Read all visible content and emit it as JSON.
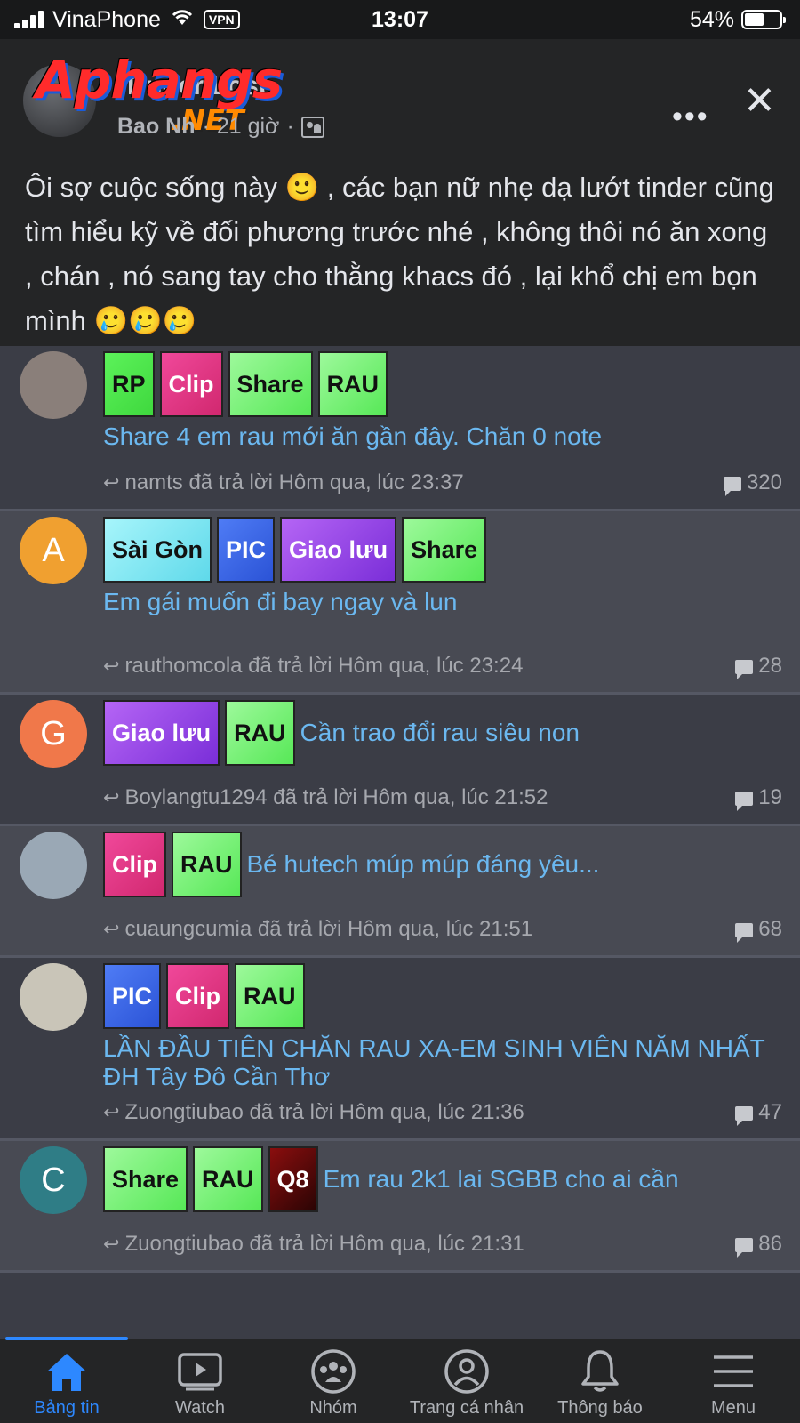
{
  "status_bar": {
    "carrier": "VinaPhone",
    "vpn": "VPN",
    "time": "13:07",
    "battery": "54%",
    "battery_level": 0.54
  },
  "post": {
    "watermark_main": "Aphangs",
    "watermark_sub": ".NET",
    "group_title": "Tinder Lost",
    "author": "Bao Nh",
    "time": "21 giờ",
    "separator": "·",
    "text": "Ôi sợ cuộc sống này 🙂 , các bạn nữ nhẹ dạ lướt tinder cũng tìm hiểu kỹ về đối phương trước nhé , không thôi nó ăn xong , chán , nó sang tay cho thằng khacs đó , lại khổ chị em bọn mình 🥲🥲🥲",
    "more_icon": "more-icon",
    "close_icon": "close-icon"
  },
  "threads": [
    {
      "tags": [
        {
          "label": "RP",
          "color": "green"
        },
        {
          "label": "Clip",
          "color": "pink"
        },
        {
          "label": "Share",
          "color": "lgreen"
        },
        {
          "label": "RAU",
          "color": "lgreen"
        }
      ],
      "title": "Share 4 em rau mới ăn gần đây. Chăn 0 note",
      "reply": "namts đã trả lời Hôm qua, lúc 23:37",
      "count": "320",
      "avatar_letter": "",
      "avatar_color": "#8a7f7a"
    },
    {
      "tags": [
        {
          "label": "Sài Gòn",
          "color": "cyan"
        },
        {
          "label": "PIC",
          "color": "blue"
        },
        {
          "label": "Giao lưu",
          "color": "purple"
        },
        {
          "label": "Share",
          "color": "lgreen"
        }
      ],
      "title": "Em gái muốn đi bay ngay và lun",
      "reply": "rauthomcola đã trả lời Hôm qua, lúc 23:24",
      "count": "28",
      "avatar_letter": "A",
      "avatar_color": "#f0a030"
    },
    {
      "tags": [
        {
          "label": "Giao lưu",
          "color": "purple"
        },
        {
          "label": "RAU",
          "color": "lgreen"
        }
      ],
      "title": "Cần trao đổi rau siêu non",
      "reply": "Boylangtu1294 đã trả lời Hôm qua, lúc 21:52",
      "count": "19",
      "avatar_letter": "G",
      "avatar_color": "#f0784a"
    },
    {
      "tags": [
        {
          "label": "Clip",
          "color": "pink"
        },
        {
          "label": "RAU",
          "color": "lgreen"
        }
      ],
      "title": "Bé hutech múp múp đáng yêu...",
      "reply": "cuaungcumia đã trả lời Hôm qua, lúc 21:51",
      "count": "68",
      "avatar_letter": "",
      "avatar_color": "#9aa8b5"
    },
    {
      "tags": [
        {
          "label": "PIC",
          "color": "blue"
        },
        {
          "label": "Clip",
          "color": "pink"
        },
        {
          "label": "RAU",
          "color": "lgreen"
        }
      ],
      "title": "LẦN ĐẦU TIÊN CHĂN RAU XA-EM SINH VIÊN NĂM NHẤT ĐH Tây Đô Cần Thơ",
      "reply": "Zuongtiubao đã trả lời Hôm qua, lúc 21:36",
      "count": "47",
      "avatar_letter": "",
      "avatar_color": "#c9c5b8"
    },
    {
      "tags": [
        {
          "label": "Share",
          "color": "lgreen"
        },
        {
          "label": "RAU",
          "color": "lgreen"
        },
        {
          "label": "Q8",
          "color": "dred"
        }
      ],
      "title": "Em rau 2k1 lai SGBB cho ai cần",
      "reply": "Zuongtiubao đã trả lời Hôm qua, lúc 21:31",
      "count": "86",
      "avatar_letter": "C",
      "avatar_color": "#2f7d86"
    }
  ],
  "bottom_nav": [
    {
      "label": "Bảng tin",
      "icon": "home-icon",
      "active": true
    },
    {
      "label": "Watch",
      "icon": "watch-icon",
      "active": false
    },
    {
      "label": "Nhóm",
      "icon": "groups-icon",
      "active": false
    },
    {
      "label": "Trang cá nhân",
      "icon": "profile-icon",
      "active": false
    },
    {
      "label": "Thông báo",
      "icon": "bell-icon",
      "active": false
    },
    {
      "label": "Menu",
      "icon": "menu-icon",
      "active": false
    }
  ],
  "colors": {
    "accent": "#2d88ff",
    "link": "#6bb8f0",
    "background": "#242526"
  }
}
